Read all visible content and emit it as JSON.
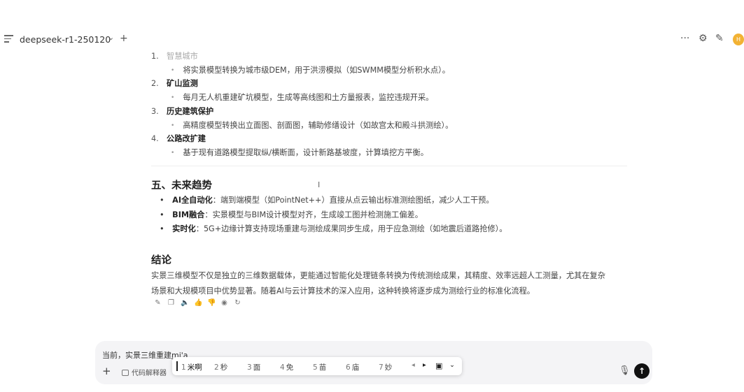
{
  "header": {
    "model_name": "deepseek-r1-250120",
    "chevron": "⌄",
    "plus": "+",
    "more": "···",
    "settings": "⚙",
    "edit": "✎",
    "avatar_initial": "H"
  },
  "content": {
    "list": [
      {
        "num": "1.",
        "title": "智慧城市",
        "sub": "将实景模型转换为城市级DEM，用于洪涝模拟（如SWMM模型分析积水点）。"
      },
      {
        "num": "2.",
        "title": "矿山监测",
        "sub": "每月无人机重建矿坑模型，生成等高线图和土方量报表，监控违规开采。"
      },
      {
        "num": "3.",
        "title": "历史建筑保护",
        "sub": "高精度模型转换出立面图、剖面图，辅助修缮设计（如故宫太和殿斗拱测绘）。"
      },
      {
        "num": "4.",
        "title": "公路改扩建",
        "sub": "基于现有道路模型提取纵/横断面，设计新路基坡度，计算填挖方平衡。"
      }
    ],
    "section5_title": "五、未来趋势",
    "trends": [
      {
        "label": "AI全自动化",
        "text": "：端到端模型（如PointNet++）直接从点云输出标准测绘图纸，减少人工干预。"
      },
      {
        "label": "BIM融合",
        "text": "：实景模型与BIM设计模型对齐，生成竣工图并检测施工偏差。"
      },
      {
        "label": "实时化",
        "text": "：5G+边缘计算支持现场重建与测绘成果同步生成，用于应急测绘（如地震后道路抢修）。"
      }
    ],
    "conclusion_title": "结论",
    "conclusion_line1": "实景三维模型不仅是独立的三维数据载体，更能通过智能化处理链条转换为传统测绘成果，其精度、效率远超人工测量，尤其在复杂",
    "conclusion_line2": "场景和大规模项目中优势显著。随着AI与云计算技术的深入应用，这种转换将逐步成为测绘行业的标准化流程。"
  },
  "toolbar_icons": [
    "edit-icon",
    "copy-icon",
    "speaker-icon",
    "thumbs-up-icon",
    "thumbs-down-icon",
    "share-icon",
    "regenerate-icon"
  ],
  "input": {
    "prefix": "当前，实景三维重建",
    "pinyin": "mi'a",
    "code_interpreter_label": "代码解释器",
    "plus": "+"
  },
  "ime": {
    "candidates": [
      {
        "n": "1",
        "t": "米啊"
      },
      {
        "n": "2",
        "t": "秒"
      },
      {
        "n": "3",
        "t": "面"
      },
      {
        "n": "4",
        "t": "免"
      },
      {
        "n": "5",
        "t": "苗"
      },
      {
        "n": "6",
        "t": "庙"
      },
      {
        "n": "7",
        "t": "妙"
      }
    ],
    "prev": "◂",
    "next": "▸",
    "expand": "⌄"
  }
}
